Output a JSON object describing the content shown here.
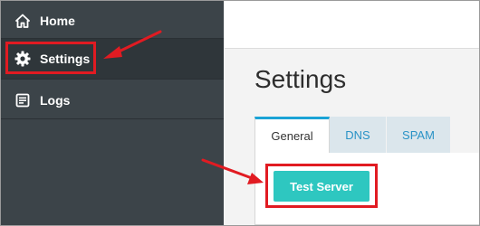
{
  "sidebar": {
    "items": [
      {
        "label": "Home",
        "icon": "home-icon"
      },
      {
        "label": "Settings",
        "icon": "gear-icon",
        "active": true
      },
      {
        "label": "Logs",
        "icon": "logs-icon"
      }
    ]
  },
  "main": {
    "title": "Settings",
    "tabs": [
      {
        "label": "General",
        "active": true
      },
      {
        "label": "DNS"
      },
      {
        "label": "SPAM"
      }
    ],
    "test_button_label": "Test Server"
  },
  "annotations": {
    "highlight_color": "#e11b22"
  },
  "colors": {
    "sidebar_bg": "#3c4449",
    "active_item_bg": "#2f363a",
    "tab_accent": "#1aa3d6",
    "button": "#2ec7c0"
  }
}
